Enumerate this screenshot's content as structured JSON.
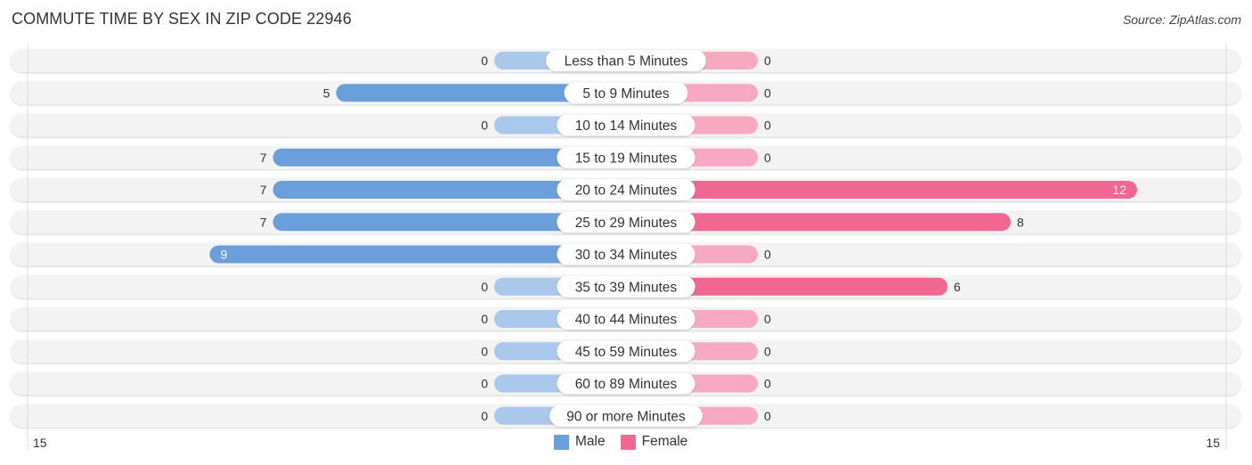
{
  "header": {
    "title": "COMMUTE TIME BY SEX IN ZIP CODE 22946",
    "source": "Source: ZipAtlas.com"
  },
  "colors": {
    "male": "#6a9fdb",
    "male_light": "#aac8ec",
    "female": "#f06892",
    "female_light": "#f7a9c1",
    "row_bg": "#f3f3f3"
  },
  "legend": {
    "male_label": "Male",
    "female_label": "Female"
  },
  "chart_data": {
    "type": "bar",
    "orientation": "horizontal-diverging",
    "title": "COMMUTE TIME BY SEX IN ZIP CODE 22946",
    "categories": [
      "Less than 5 Minutes",
      "5 to 9 Minutes",
      "10 to 14 Minutes",
      "15 to 19 Minutes",
      "20 to 24 Minutes",
      "25 to 29 Minutes",
      "30 to 34 Minutes",
      "35 to 39 Minutes",
      "40 to 44 Minutes",
      "45 to 59 Minutes",
      "60 to 89 Minutes",
      "90 or more Minutes"
    ],
    "series": [
      {
        "name": "Male",
        "values": [
          0,
          5,
          0,
          7,
          7,
          7,
          9,
          0,
          0,
          0,
          0,
          0
        ]
      },
      {
        "name": "Female",
        "values": [
          0,
          0,
          0,
          0,
          12,
          8,
          0,
          6,
          0,
          0,
          0,
          0
        ]
      }
    ],
    "axis": {
      "left_max_label": "15",
      "right_max_label": "15",
      "max": 15
    },
    "legend_position": "bottom-center"
  }
}
